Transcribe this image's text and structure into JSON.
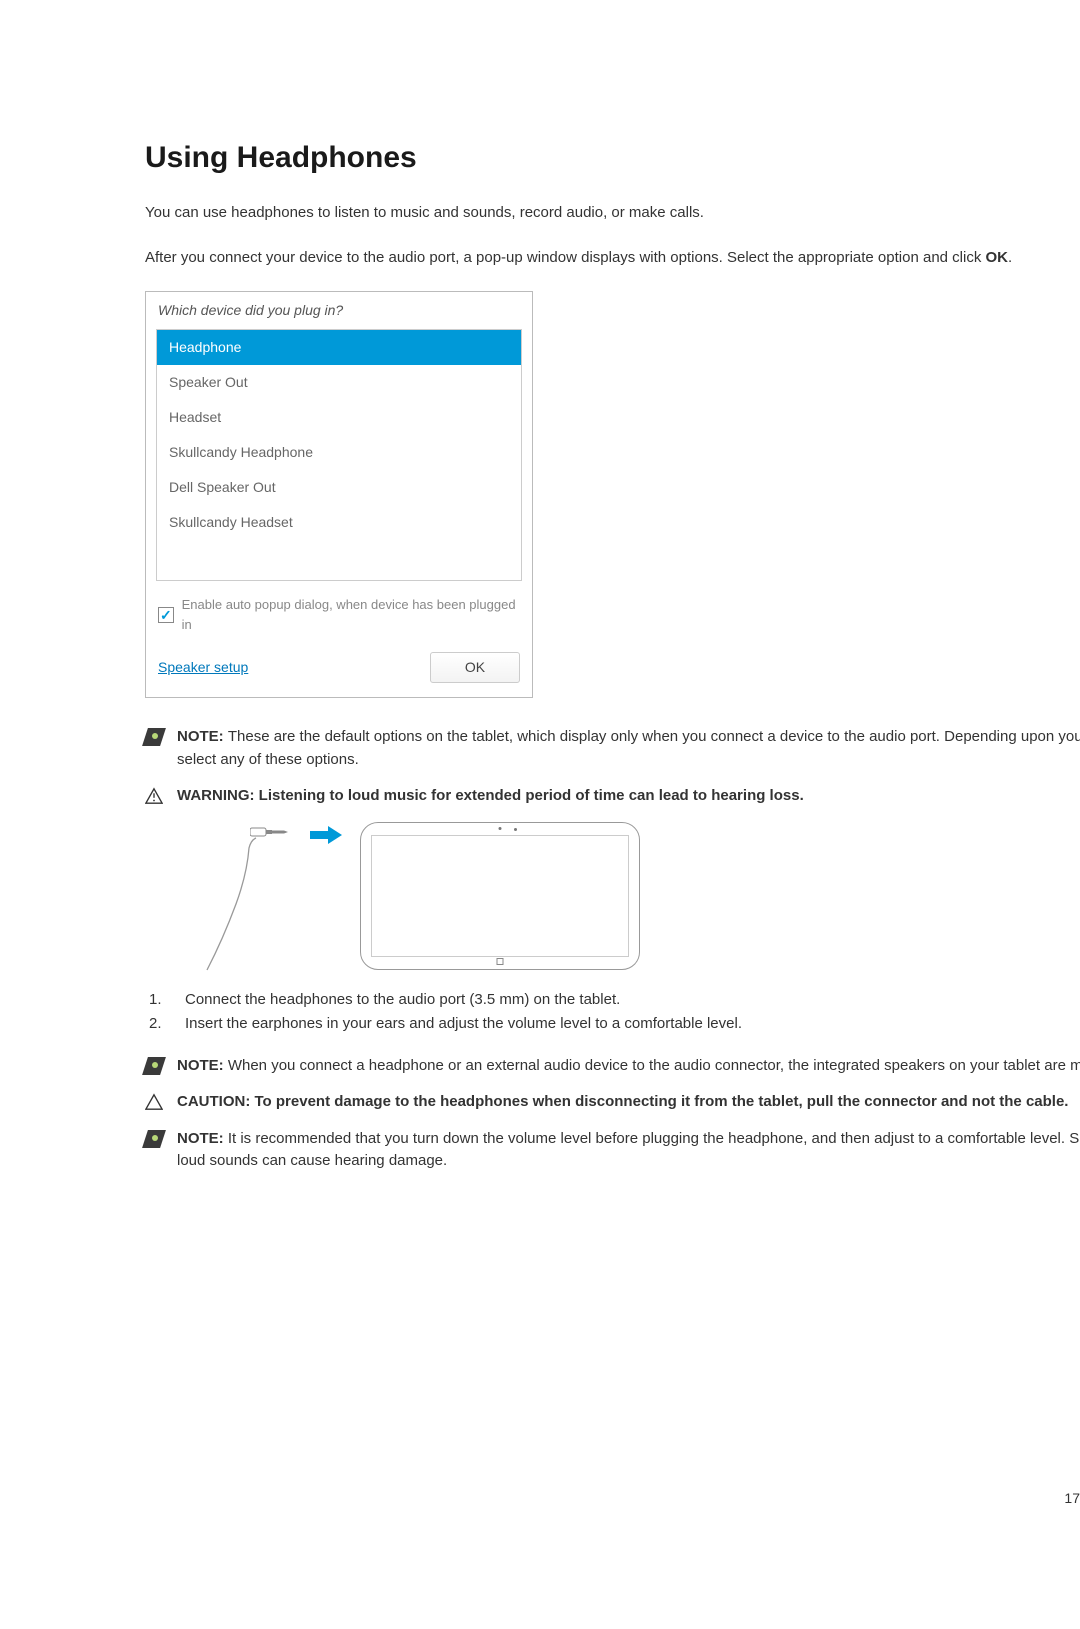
{
  "heading": "Using Headphones",
  "intro1": "You can use headphones to listen to music and sounds, record audio, or make calls.",
  "intro2_a": "After you connect your device to the audio port, a pop-up window displays with options. Select the appropriate option and click ",
  "intro2_b": "OK",
  "intro2_c": ".",
  "dialog": {
    "title": "Which device did you plug in?",
    "items": {
      "0": "Headphone",
      "1": "Speaker Out",
      "2": "Headset",
      "3": "Skullcandy Headphone",
      "4": "Dell Speaker Out",
      "5": "Skullcandy Headset"
    },
    "checkbox_label": "Enable auto popup dialog, when device has been plugged in",
    "link": "Speaker setup",
    "ok": "OK"
  },
  "callout1": {
    "label": "NOTE: ",
    "text": "These are the default options on the tablet, which display only when you connect a device to the audio port. Depending upon your device, you can select any of these options."
  },
  "callout2": {
    "label": "WARNING: ",
    "text": "Listening to loud music for extended period of time can lead to hearing loss."
  },
  "steps": {
    "0": {
      "num": "1.",
      "text": "Connect the headphones to the audio port (3.5 mm) on the tablet."
    },
    "1": {
      "num": "2.",
      "text": "Insert the earphones in your ears and adjust the volume level to a comfortable level."
    }
  },
  "callout3": {
    "label": "NOTE: ",
    "text": "When you connect a headphone or an external audio device to the audio connector, the integrated speakers on your tablet are muted automatically."
  },
  "callout4": {
    "label": "CAUTION: ",
    "text": "To prevent damage to the headphones when disconnecting it from the tablet, pull the connector and not the cable."
  },
  "callout5": {
    "label": "NOTE: ",
    "text": "It is recommended that you turn down the volume level before plugging the headphone, and then adjust to a comfortable level. Sudden exposure to loud sounds can cause hearing damage."
  },
  "page_number": "17"
}
